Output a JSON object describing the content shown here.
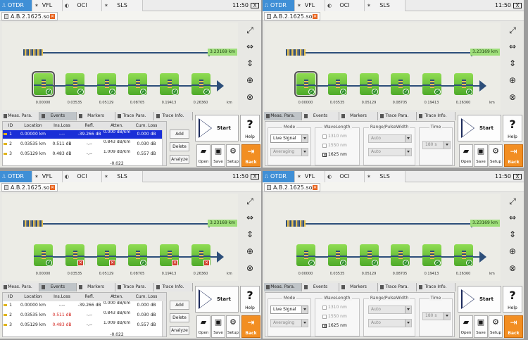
{
  "top_tabs": [
    {
      "label": "OTDR",
      "icon": "otdr-icon"
    },
    {
      "label": "VFL",
      "icon": "vfl-icon"
    },
    {
      "label": "OCI",
      "icon": "oci-icon"
    },
    {
      "label": "SLS",
      "icon": "sls-icon"
    }
  ],
  "clock": "11:50",
  "battery": "X",
  "file_tab": "A.B.2.1625.sor",
  "distance_label": "3.23169 km",
  "event_positions": [
    "0.00000",
    "0.03535",
    "0.05129",
    "0.08705",
    "0.19413",
    "0.26360"
  ],
  "axis_unit": "km",
  "bottom_tabs": [
    "Meas. Para.",
    "Events",
    "Markers",
    "Trace Para.",
    "Trace Info."
  ],
  "table": {
    "headers": [
      "ID",
      "Location",
      "Ins.Loss",
      "Refl.",
      "Atten.",
      "Cum. Loss"
    ],
    "rows": [
      {
        "id": "1",
        "location": "0.00000 km",
        "ins_loss": "-.--",
        "refl": "-39.266 dB",
        "atten": "0.000 dB/km",
        "cum_loss": "0.000 dB"
      },
      {
        "id": "2",
        "location": "0.03535 km",
        "ins_loss": "0.511 dB",
        "refl": "-.--",
        "atten": "0.843 dB/km",
        "cum_loss": "0.030 dB"
      },
      {
        "id": "3",
        "location": "0.05129 km",
        "ins_loss": "0.483 dB",
        "refl": "-.--",
        "atten": "1.009 dB/km",
        "cum_loss": "0.557 dB"
      }
    ],
    "cut_atten": "-0.022"
  },
  "actions": [
    "Add",
    "Delete",
    "Analyze"
  ],
  "start_label": "Start",
  "help_label": "Help",
  "tools": [
    "Open",
    "Save",
    "Setup",
    "Back"
  ],
  "meas": {
    "mode_title": "Mode",
    "mode_value": "Live Signal",
    "mode_sub": "Averaging",
    "wavelength_title": "WaveLength",
    "wavelengths": [
      "1310 nm",
      "1550 nm",
      "1625 nm"
    ],
    "range_title": "Range/PulseWidth",
    "range_value": "Auto",
    "pulse_value": "Auto",
    "time_title": "Time",
    "time_value": "180 s"
  }
}
